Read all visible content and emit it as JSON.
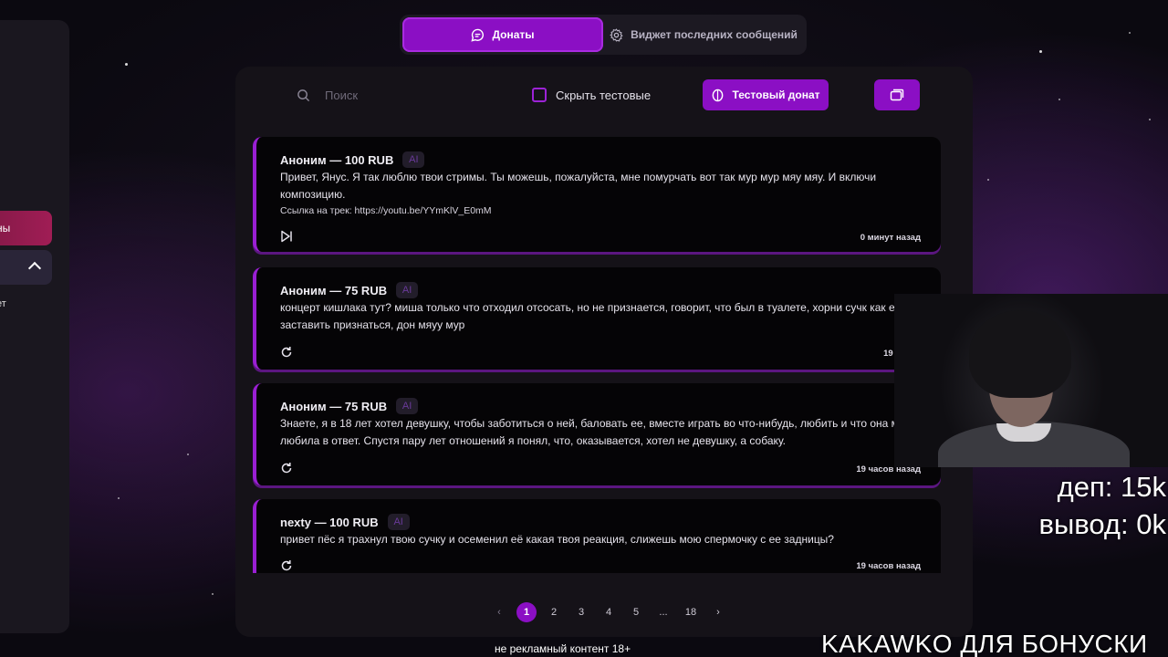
{
  "sidebar": {
    "active_item": "ны",
    "sub_item": "ет"
  },
  "tabs": [
    {
      "label": "Донаты",
      "icon": "chat-bubble-icon"
    },
    {
      "label": "Виджет последних сообщений",
      "icon": "gear-icon"
    }
  ],
  "toolbar": {
    "search_placeholder": "Поиск",
    "hide_test_label": "Скрыть тестовые",
    "test_donate_label": "Тестовый донат"
  },
  "donations": [
    {
      "author": "Аноним — 100 RUB",
      "badge": "AI",
      "message": "Привет, Янус. Я так люблю твои стримы. Ты можешь, пожалуйста, мне помурчать вот так мур мур мяу мяу. И включи композицию.",
      "link": "Ссылка на трек: https://youtu.be/YYmKlV_E0mM",
      "time": "0 минут назад",
      "action_icon": "skip-next-icon"
    },
    {
      "author": "Аноним — 75 RUB",
      "badge": "AI",
      "message": "концерт кишлака тут? миша только что отходил отсосать, но не признается, говорит, что был в туалете, хорни сучк как его заставить признаться, дон мяуу мур",
      "time": "19 часов",
      "action_icon": "replay-icon"
    },
    {
      "author": "Аноним — 75 RUB",
      "badge": "AI",
      "message": "Знаете, я в 18 лет хотел девушку, чтобы заботиться о ней, баловать ее, вместе играть во что-нибудь, любить и что она меня любила в ответ. Спустя пару лет отношений я понял, что, оказывается, хотел не девушку, а собаку.",
      "time": "19 часов назад",
      "action_icon": "replay-icon"
    },
    {
      "author": "nexty — 100 RUB",
      "badge": "AI",
      "message": "привет пёс я трахнул твою сучку и осеменил её какая твоя реакция, слижешь мою спермочку с ее задницы?",
      "time": "19 часов назад",
      "action_icon": "replay-icon"
    }
  ],
  "pagination": {
    "prev": "‹",
    "pages": [
      "1",
      "2",
      "3",
      "4",
      "5",
      "...",
      "18"
    ],
    "current": "1",
    "next": "›"
  },
  "overlay": {
    "deposit": "деп: 15k",
    "withdraw": "вывод: 0k",
    "promo": "KAKAWKO ДЛЯ БОНУСКИ",
    "disclaimer": "не рекламный контент 18+"
  },
  "colors": {
    "accent": "#8b0fc4",
    "card_border": "#9a1fd3",
    "sidebar_active": "#a01d55"
  }
}
